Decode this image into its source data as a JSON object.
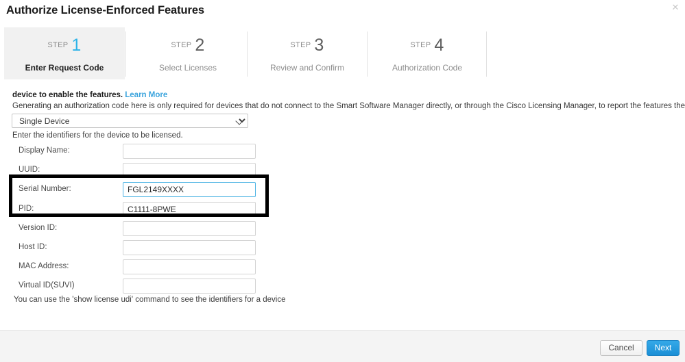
{
  "dialog": {
    "title": "Authorize License-Enforced Features",
    "close_icon": "close-icon"
  },
  "steps": [
    {
      "head": "STEP",
      "number": "1",
      "label": "Enter Request Code",
      "active": true
    },
    {
      "head": "STEP",
      "number": "2",
      "label": "Select Licenses",
      "active": false
    },
    {
      "head": "STEP",
      "number": "3",
      "label": "Review and Confirm",
      "active": false
    },
    {
      "head": "STEP",
      "number": "4",
      "label": "Authorization Code",
      "active": false
    }
  ],
  "body": {
    "intro_text": "device to enable the features.",
    "learn_more_label": "Learn More",
    "description": "Generating an authorization code here is only required for devices that do not connect to the Smart Software Manager directly, or through the Cisco Licensing Manager, to report the features they need.",
    "identifiers_hint": "Enter the identifiers for the device to be licensed.",
    "udi_hint": "You can use the 'show license udi' command to see the identifiers for a device"
  },
  "device_select": {
    "selected": "Single Device",
    "options": [
      "Single Device"
    ],
    "caret_icon": "chevron-down-icon"
  },
  "form": {
    "fields": [
      {
        "label": "Display Name:",
        "value": "",
        "placeholder": "",
        "focused": false
      },
      {
        "label": "UUID:",
        "value": "",
        "placeholder": "",
        "focused": false
      },
      {
        "label": "Serial Number:",
        "value": "FGL2149XXXX",
        "placeholder": "",
        "focused": true
      },
      {
        "label": "PID:",
        "value": "C1111-8PWE",
        "placeholder": "",
        "focused": false
      },
      {
        "label": "Version ID:",
        "value": "",
        "placeholder": "",
        "focused": false
      },
      {
        "label": "Host ID:",
        "value": "",
        "placeholder": "",
        "focused": false
      },
      {
        "label": "MAC Address:",
        "value": "",
        "placeholder": "",
        "focused": false
      },
      {
        "label": "Virtual ID(SUVI)",
        "value": "",
        "placeholder": "",
        "focused": false
      }
    ]
  },
  "footer": {
    "cancel_label": "Cancel",
    "next_label": "Next"
  },
  "colors": {
    "accent_blue": "#2bb3e8",
    "link_blue": "#3ba4dd",
    "primary_button": "#1b8fd6",
    "active_step_bg": "#f1f1f1",
    "highlight_border": "#000000",
    "footer_bg": "#f4f4f4"
  }
}
